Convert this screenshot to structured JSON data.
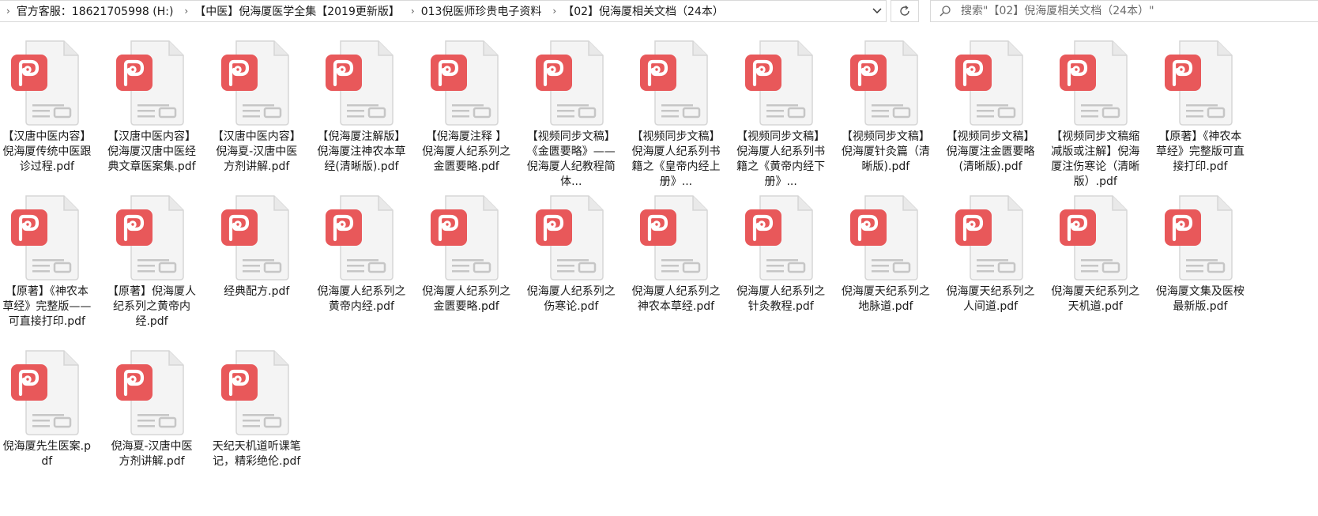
{
  "breadcrumb": [
    "官方客服：18621705998 (H:)",
    "【中医】倪海厦医学全集【2019更新版】",
    "013倪医师珍贵电子资料",
    "【02】倪海厦相关文档（24本）"
  ],
  "search": {
    "placeholder": "搜索\"【02】倪海厦相关文档（24本）\""
  },
  "icons": {
    "dropdown": "chevron-down-icon",
    "refresh": "refresh-icon",
    "search": "search-icon",
    "file": "pdf-file-icon"
  },
  "colors": {
    "pdf_badge": "#e8585a",
    "page": "#f5f5f5",
    "border": "#d9d9d9"
  },
  "files": [
    "【汉唐中医内容】倪海厦传统中医跟诊过程.pdf",
    "【汉唐中医内容】倪海厦汉唐中医经典文章医案集.pdf",
    "【汉唐中医内容】倪海夏-汉唐中医方剂讲解.pdf",
    "【倪海厦注解版】倪海厦注神农本草经(清晰版).pdf",
    "【倪海厦注释 】倪海厦人纪系列之金匮要略.pdf",
    "【视频同步文稿】《金匮要略》——倪海厦人纪教程简体...",
    "【视频同步文稿】倪海厦人纪系列书籍之《皇帝内经上册》...",
    "【视频同步文稿】倪海厦人纪系列书籍之《黄帝内经下册》...",
    "【视频同步文稿】倪海厦针灸篇（清晰版).pdf",
    "【视频同步文稿】倪海厦注金匮要略(清晰版).pdf",
    "【视频同步文稿缩减版或注解】倪海厦注伤寒论（清晰版）.pdf",
    "【原著】《神农本草经》完整版可直接打印.pdf",
    "【原著】《神农本草经》完整版——可直接打印.pdf",
    "【原著】倪海厦人纪系列之黄帝内经.pdf",
    "经典配方.pdf",
    "倪海厦人纪系列之黄帝内经.pdf",
    "倪海厦人纪系列之金匮要略.pdf",
    "倪海厦人纪系列之伤寒论.pdf",
    "倪海厦人纪系列之神农本草经.pdf",
    "倪海厦人纪系列之针灸教程.pdf",
    "倪海厦天纪系列之地脉道.pdf",
    "倪海厦天纪系列之人间道.pdf",
    "倪海厦天纪系列之天机道.pdf",
    "倪海厦文集及医桉最新版.pdf",
    "倪海厦先生医案.pdf",
    "倪海夏-汉唐中医方剂讲解.pdf",
    "天纪天机道听课笔记，精彩绝伦.pdf"
  ]
}
